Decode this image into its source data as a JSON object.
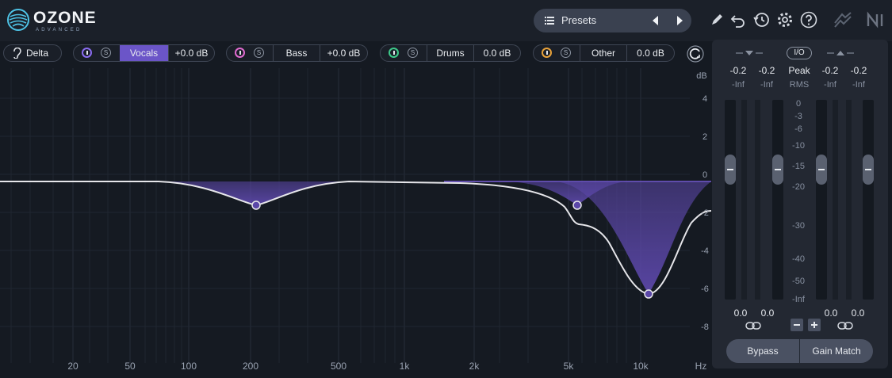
{
  "app": {
    "name": "OZONE",
    "edition": "ADVANCED"
  },
  "presets": {
    "label": "Presets"
  },
  "bands": [
    {
      "name": "Delta"
    },
    {
      "name": "Vocals",
      "gain": "+0.0 dB",
      "accent": "#8a6cf0",
      "selected": true
    },
    {
      "name": "Bass",
      "gain": "+0.0 dB",
      "accent": "#e06bd0"
    },
    {
      "name": "Drums",
      "gain": "0.0 dB",
      "accent": "#3ec98a"
    },
    {
      "name": "Other",
      "gain": "0.0 dB",
      "accent": "#e8a23a"
    }
  ],
  "solo_label": "S",
  "db_axis": {
    "unit": "dB",
    "ticks": [
      "4",
      "2",
      "0",
      "-2",
      "-4",
      "-6",
      "-8"
    ]
  },
  "freq_axis": {
    "unit": "Hz",
    "ticks": [
      "20",
      "50",
      "100",
      "200",
      "500",
      "1k",
      "2k",
      "5k",
      "10k"
    ]
  },
  "meters": {
    "io_label": "I/O",
    "peak_label": "Peak",
    "rms_label": "RMS",
    "input_peak": [
      "-0.2",
      "-0.2"
    ],
    "output_peak": [
      "-0.2",
      "-0.2"
    ],
    "input_rms": [
      "-Inf",
      "-Inf"
    ],
    "output_rms": [
      "-Inf",
      "-Inf"
    ],
    "input_gain": [
      "0.0",
      "0.0"
    ],
    "output_gain": [
      "0.0",
      "0.0"
    ],
    "scale": [
      "0",
      "-3",
      "-6",
      "-10",
      "-15",
      "-20",
      "-30",
      "-40",
      "-50",
      "-Inf"
    ]
  },
  "buttons": {
    "bypass": "Bypass",
    "gain_match": "Gain Match"
  },
  "colors": {
    "accent": "#7b5fd9",
    "curve": "#e6e6ea",
    "fill": "#4b3a86"
  }
}
